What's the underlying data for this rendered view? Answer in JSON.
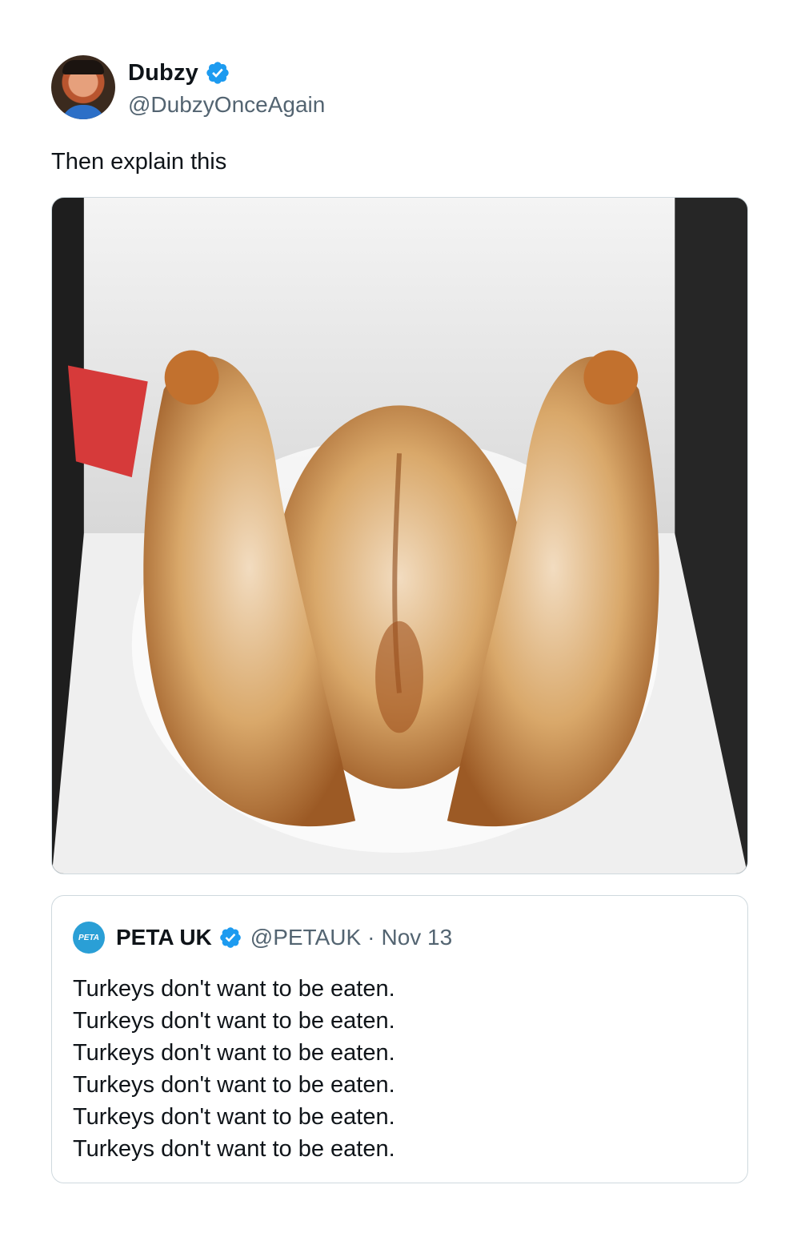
{
  "tweet": {
    "author": {
      "display_name": "Dubzy",
      "handle": "@DubzyOnceAgain",
      "verified": true,
      "avatar_icon": "user-avatar-photo"
    },
    "text": "Then explain this",
    "media": {
      "icon": "roast-turkey-photo"
    },
    "quoted_tweet": {
      "author": {
        "display_name": "PETA UK",
        "handle": "@PETAUK",
        "verified": true,
        "avatar_label": "PETA"
      },
      "separator": "·",
      "date": "Nov 13",
      "lines": [
        "Turkeys don't want to be eaten.",
        "Turkeys don't want to be eaten.",
        "Turkeys don't want to be eaten.",
        "Turkeys don't want to be eaten.",
        "Turkeys don't want to be eaten.",
        "Turkeys don't want to be eaten."
      ]
    }
  },
  "colors": {
    "verified_blue": "#1d9bf0",
    "secondary_text": "#536471",
    "border": "#cfd9de"
  }
}
